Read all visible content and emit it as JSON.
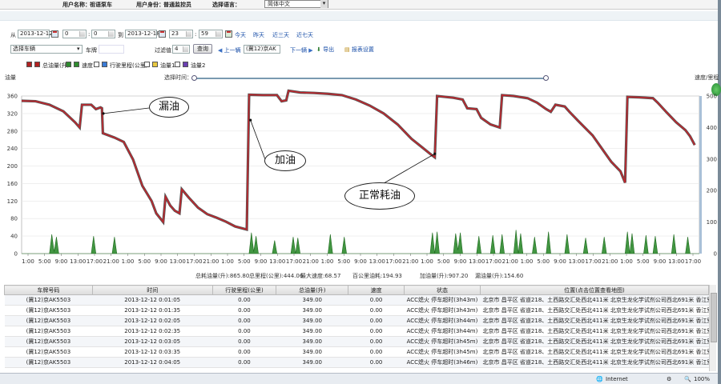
{
  "header": {
    "user_name_label": "用户名称：",
    "user_name": "祖语泵车",
    "user_role_label": "用户身份：",
    "user_role": "普通监控员",
    "language_label": "选择语言：",
    "language_value": "简体中文"
  },
  "filters": {
    "from_label": "从",
    "start_date": "2013-12-12",
    "start_hour": "0",
    "start_min": "0",
    "to_label": "到",
    "end_date": "2013-12-18",
    "end_hour": "23",
    "end_min": "59",
    "today": "今天",
    "yesterday": "昨天",
    "last3": "近三天",
    "last7": "近七天",
    "vehicle_select": "选择车辆",
    "plate_label": "车牌",
    "plate_value": "",
    "filter_label": "过滤值",
    "filter_value": "4",
    "query": "查询",
    "prev": "上一辆",
    "current_vehicle": "(冀12)京AK",
    "next": "下一辆",
    "export": "导出",
    "report_settings": "报表设置"
  },
  "legend": [
    {
      "label": "总油量(升)",
      "checked": true,
      "color": "#b22222"
    },
    {
      "label": "速度",
      "checked": true,
      "color": "#2e8b2e"
    },
    {
      "label": "行驶里程(公里)",
      "checked": false,
      "color": "#3a7bd5"
    },
    {
      "label": "油量1",
      "checked": false,
      "color": "#e8c840"
    },
    {
      "label": "油量2",
      "checked": false,
      "color": "#6a3fb0"
    }
  ],
  "chart_labels": {
    "left_axis": "油量",
    "right_axis": "速度/里程",
    "time_select": "选择时间："
  },
  "chart_data": {
    "type": "line",
    "x_ticks": [
      "1:00",
      "5:00",
      "9:00",
      "13:00",
      "17:00",
      "21:00",
      "1:00",
      "5:00",
      "9:00",
      "13:00",
      "17:00",
      "21:00",
      "1:00",
      "5:00",
      "9:00",
      "13:00",
      "17:00",
      "21:00",
      "1:00",
      "5:00",
      "9:00",
      "13:00",
      "17:00",
      "21:00",
      "1:00",
      "5:00",
      "9:00",
      "13:00",
      "17:00",
      "21:00",
      "1:00",
      "5:00",
      "9:00",
      "13:00",
      "17:00",
      "21:00",
      "1:00",
      "5:00",
      "9:00",
      "13:00",
      "17:00"
    ],
    "ylim_left": [
      0,
      360
    ],
    "yticks_left": [
      0,
      40,
      80,
      120,
      160,
      200,
      240,
      280,
      320,
      360
    ],
    "ylim_right": [
      0,
      500
    ],
    "yticks_right": [
      0,
      100,
      200,
      300,
      400,
      500
    ],
    "series": [
      {
        "name": "总油量(升)",
        "points": [
          [
            0,
            349
          ],
          [
            3,
            348
          ],
          [
            6,
            340
          ],
          [
            9,
            325
          ],
          [
            11.5,
            300
          ],
          [
            12.5,
            288
          ],
          [
            13,
            340
          ],
          [
            15,
            340
          ],
          [
            16,
            330
          ],
          [
            17,
            334
          ],
          [
            17.3,
            332
          ],
          [
            17.5,
            275
          ],
          [
            20,
            265
          ],
          [
            22,
            255
          ],
          [
            24,
            215
          ],
          [
            26,
            155
          ],
          [
            28,
            120
          ],
          [
            29,
            92
          ],
          [
            30.5,
            72
          ],
          [
            31,
            130
          ],
          [
            32,
            110
          ],
          [
            33,
            98
          ],
          [
            34,
            92
          ],
          [
            34.5,
            147
          ],
          [
            36,
            128
          ],
          [
            38,
            105
          ],
          [
            40,
            90
          ],
          [
            42,
            82
          ],
          [
            44,
            73
          ],
          [
            46,
            62
          ],
          [
            48.5,
            55
          ],
          [
            49,
            363
          ],
          [
            52,
            362
          ],
          [
            55,
            362
          ],
          [
            56,
            348
          ],
          [
            57,
            350
          ],
          [
            57.5,
            372
          ],
          [
            60,
            368
          ],
          [
            63,
            367
          ],
          [
            66,
            365
          ],
          [
            69,
            362
          ],
          [
            72,
            352
          ],
          [
            75,
            338
          ],
          [
            78,
            320
          ],
          [
            81,
            295
          ],
          [
            84,
            262
          ],
          [
            86,
            245
          ],
          [
            88,
            228
          ],
          [
            89,
            220
          ],
          [
            89.5,
            360
          ],
          [
            93,
            356
          ],
          [
            95,
            352
          ],
          [
            96,
            332
          ],
          [
            98,
            330
          ],
          [
            99,
            310
          ],
          [
            101,
            295
          ],
          [
            103,
            288
          ],
          [
            103.5,
            362
          ],
          [
            106,
            360
          ],
          [
            109,
            355
          ],
          [
            111,
            345
          ],
          [
            113,
            330
          ],
          [
            114,
            324
          ],
          [
            115,
            340
          ],
          [
            117,
            336
          ],
          [
            118,
            324
          ],
          [
            120,
            302
          ],
          [
            123,
            270
          ],
          [
            125,
            240
          ],
          [
            127,
            210
          ],
          [
            129,
            188
          ],
          [
            130,
            162
          ],
          [
            130.5,
            358
          ],
          [
            133,
            357
          ],
          [
            136,
            355
          ],
          [
            137,
            345
          ],
          [
            139,
            322
          ],
          [
            141,
            300
          ],
          [
            143,
            282
          ],
          [
            144,
            268
          ],
          [
            145,
            248
          ]
        ]
      },
      {
        "name": "速度",
        "points": [
          [
            6,
            0
          ],
          [
            6.5,
            44
          ],
          [
            7,
            4
          ],
          [
            7.5,
            38
          ],
          [
            8,
            0
          ],
          [
            15,
            0
          ],
          [
            15.5,
            40
          ],
          [
            16,
            0
          ],
          [
            19.5,
            0
          ],
          [
            20,
            38
          ],
          [
            20.5,
            0
          ],
          [
            49,
            0
          ],
          [
            49.5,
            48
          ],
          [
            50,
            4
          ],
          [
            50.5,
            40
          ],
          [
            51,
            0
          ],
          [
            54,
            0
          ],
          [
            54.5,
            30
          ],
          [
            55,
            0
          ],
          [
            58,
            0
          ],
          [
            58.5,
            38
          ],
          [
            59,
            0
          ],
          [
            59.5,
            36
          ],
          [
            60,
            0
          ],
          [
            66,
            0
          ],
          [
            66.5,
            44
          ],
          [
            67,
            0
          ],
          [
            69,
            0
          ],
          [
            69.5,
            38
          ],
          [
            70,
            0
          ],
          [
            88,
            0
          ],
          [
            88.5,
            48
          ],
          [
            89,
            0
          ],
          [
            89.5,
            50
          ],
          [
            90,
            0
          ],
          [
            93,
            0
          ],
          [
            93.5,
            46
          ],
          [
            94,
            8
          ],
          [
            94.5,
            48
          ],
          [
            95,
            0
          ],
          [
            98,
            0
          ],
          [
            98.5,
            40
          ],
          [
            99,
            0
          ],
          [
            101,
            0
          ],
          [
            101.5,
            42
          ],
          [
            102,
            0
          ],
          [
            103,
            0
          ],
          [
            103.5,
            44
          ],
          [
            104,
            0
          ],
          [
            106,
            0
          ],
          [
            106.5,
            54
          ],
          [
            107,
            0
          ],
          [
            107.5,
            46
          ],
          [
            108,
            0
          ],
          [
            110,
            0
          ],
          [
            110.5,
            38
          ],
          [
            111,
            0
          ],
          [
            113,
            0
          ],
          [
            113.5,
            50
          ],
          [
            114,
            0
          ],
          [
            117,
            0
          ],
          [
            117.5,
            44
          ],
          [
            118,
            0
          ],
          [
            121,
            0
          ],
          [
            121.5,
            36
          ],
          [
            122,
            0
          ],
          [
            125,
            0
          ],
          [
            125.5,
            38
          ],
          [
            126,
            0
          ],
          [
            130,
            0
          ],
          [
            130.5,
            50
          ],
          [
            131,
            0
          ],
          [
            131.5,
            46
          ],
          [
            132,
            0
          ],
          [
            134,
            0
          ],
          [
            134.5,
            42
          ],
          [
            135,
            0
          ],
          [
            136,
            0
          ],
          [
            136.5,
            40
          ],
          [
            137,
            0
          ],
          [
            140,
            0
          ],
          [
            140.5,
            44
          ],
          [
            141,
            0
          ],
          [
            143,
            0
          ],
          [
            143.5,
            38
          ],
          [
            144,
            0
          ],
          [
            145,
            0
          ]
        ]
      }
    ],
    "annotations": [
      {
        "text": "漏油",
        "at": [
          17.4,
          310
        ]
      },
      {
        "text": "加油",
        "at": [
          49,
          340
        ]
      },
      {
        "text": "正常耗油",
        "at": [
          86,
          245
        ]
      }
    ]
  },
  "stats": {
    "total_consumption": "总耗油量(升):865.80",
    "total_mileage": "总里程(公里):444.06",
    "max_speed": "最大速度:68.57",
    "per100": "百公里油耗:194.93",
    "refuel": "加油量(升):907.20",
    "leak": "漏油量(升):154.60"
  },
  "table": {
    "columns": [
      "车牌号码",
      "时间",
      "行驶里程(公里)",
      "总油量(升)",
      "速度",
      "状态",
      "位置(点击位置查看地图)"
    ],
    "rows": [
      [
        "(冀12)京AK5503",
        "2013-12-12 0:01:05",
        "0.00",
        "349.00",
        "0.00",
        "ACC熄火 停车超时(3h43m)",
        "北京市 昌平区 省道218、土西路交汇处西北411米 北京生龙化学试剂公司西北691米 香江别墅..."
      ],
      [
        "(冀12)京AK5503",
        "2013-12-12 0:01:35",
        "0.00",
        "349.00",
        "0.00",
        "ACC熄火 停车超时(3h43m)",
        "北京市 昌平区 省道218、土西路交汇处西北411米 北京生龙化学试剂公司西北691米 香江别墅..."
      ],
      [
        "(冀12)京AK5503",
        "2013-12-12 0:02:05",
        "0.00",
        "349.00",
        "0.00",
        "ACC熄火 停车超时(3h44m)",
        "北京市 昌平区 省道218、土西路交汇处西北411米 北京生龙化学试剂公司西北691米 香江别墅..."
      ],
      [
        "(冀12)京AK5503",
        "2013-12-12 0:02:35",
        "0.00",
        "349.00",
        "0.00",
        "ACC熄火 停车超时(3h44m)",
        "北京市 昌平区 省道218、土西路交汇处西北411米 北京生龙化学试剂公司西北691米 香江别墅..."
      ],
      [
        "(冀12)京AK5503",
        "2013-12-12 0:03:05",
        "0.00",
        "349.00",
        "0.00",
        "ACC熄火 停车超时(3h45m)",
        "北京市 昌平区 省道218、土西路交汇处西北411米 北京生龙化学试剂公司西北691米 香江别墅..."
      ],
      [
        "(冀12)京AK5503",
        "2013-12-12 0:03:35",
        "0.00",
        "349.00",
        "0.00",
        "ACC熄火 停车超时(3h45m)",
        "北京市 昌平区 省道218、土西路交汇处西北411米 北京生龙化学试剂公司西北691米 香江别墅..."
      ],
      [
        "(冀12)京AK5503",
        "2013-12-12 0:04:05",
        "0.00",
        "349.00",
        "0.00",
        "ACC熄火 停车超时(3h46m)",
        "北京市 昌平区 省道218、土西路交汇处西北411米 北京生龙化学试剂公司西北691米 香江别墅..."
      ]
    ]
  },
  "statusbar": {
    "zone": "Internet",
    "zoom": "100%"
  }
}
